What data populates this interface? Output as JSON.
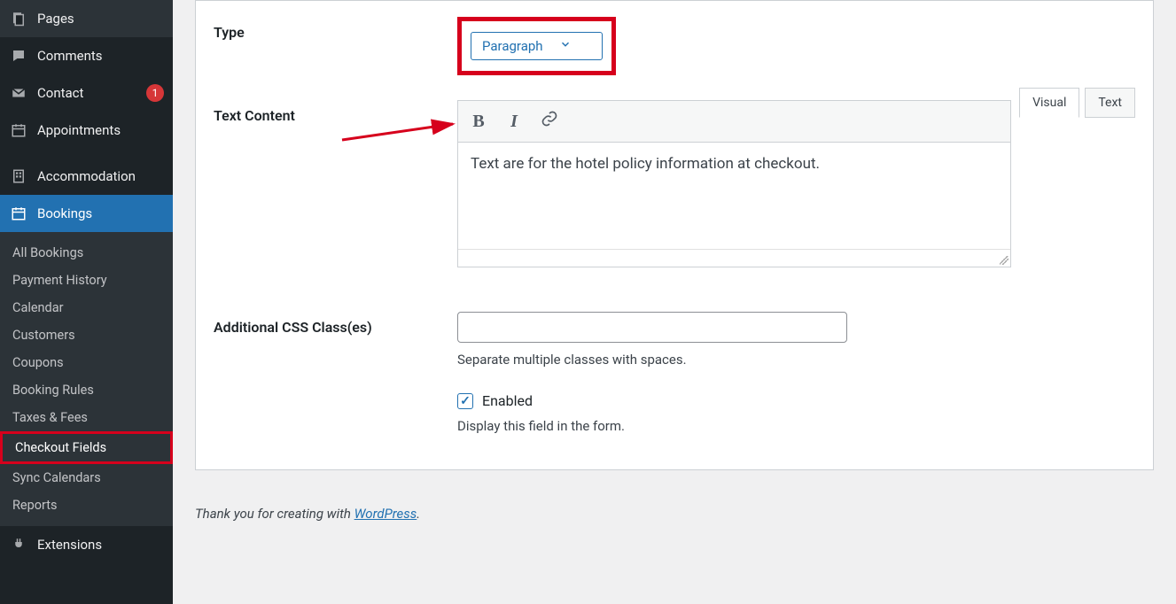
{
  "sidebar": {
    "top": [
      {
        "label": "Pages",
        "icon": "pages"
      },
      {
        "label": "Comments",
        "icon": "comments"
      },
      {
        "label": "Contact",
        "icon": "contact",
        "badge": "1"
      },
      {
        "label": "Appointments",
        "icon": "calendar"
      }
    ],
    "accommodation": "Accommodation",
    "bookings": "Bookings",
    "submenu": [
      "All Bookings",
      "Payment History",
      "Calendar",
      "Customers",
      "Coupons",
      "Booking Rules",
      "Taxes & Fees",
      "Checkout Fields",
      "Sync Calendars",
      "Reports"
    ],
    "extensions": "Extensions"
  },
  "form": {
    "type_label": "Type",
    "type_value": "Paragraph",
    "text_content_label": "Text Content",
    "tabs": {
      "visual": "Visual",
      "text": "Text"
    },
    "editor_content": "Text are for the hotel policy information at checkout.",
    "css_label": "Additional CSS Class(es)",
    "css_help": "Separate multiple classes with spaces.",
    "enabled_label": "Enabled",
    "enabled_help": "Display this field in the form."
  },
  "footer": {
    "prefix": "Thank you for creating with ",
    "link": "WordPress",
    "suffix": "."
  }
}
